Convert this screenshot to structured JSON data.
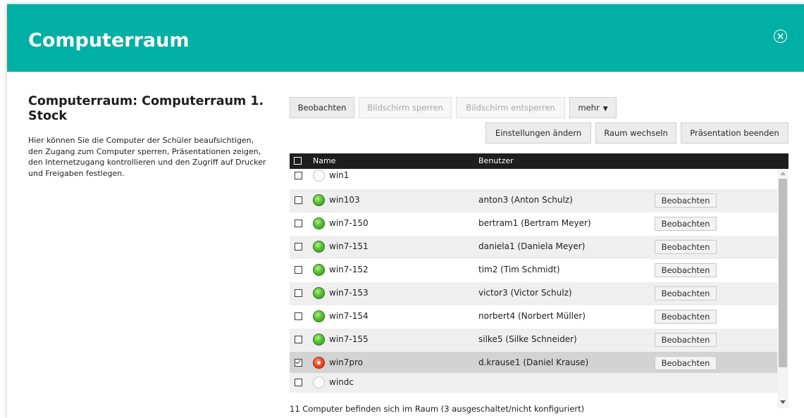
{
  "header": {
    "title": "Computerraum",
    "close_icon": "close-circle-icon",
    "color": "#00b0a4"
  },
  "sidebar": {
    "title": "Computerraum: Computerraum 1. Stock",
    "description": "Hier können Sie die Computer der Schüler beaufsichtigen, den Zugang zum Computer sperren, Präsentationen zeigen, den Internetzugang kontrollieren und den Zugriff auf Drucker und Freigaben festlegen."
  },
  "toolbar": {
    "observe": "Beobachten",
    "lock_screen": "Bildschirm sperren",
    "unlock_screen": "Bildschirm entsperren",
    "more": "mehr",
    "change_settings": "Einstellungen ändern",
    "change_room": "Raum wechseln",
    "end_presentation": "Präsentation beenden"
  },
  "grid": {
    "columns": [
      "Name",
      "Benutzer"
    ],
    "row_button_label": "Beobachten",
    "rows": [
      {
        "name": "win1",
        "user": "",
        "status": "off",
        "checked": false,
        "has_button": false
      },
      {
        "name": "win103",
        "user": "anton3 (Anton Schulz)",
        "status": "on",
        "checked": false,
        "has_button": true
      },
      {
        "name": "win7-150",
        "user": "bertram1 (Bertram Meyer)",
        "status": "on",
        "checked": false,
        "has_button": true
      },
      {
        "name": "win7-151",
        "user": "daniela1 (Daniela Meyer)",
        "status": "on",
        "checked": false,
        "has_button": true
      },
      {
        "name": "win7-152",
        "user": "tim2 (Tim Schmidt)",
        "status": "on",
        "checked": false,
        "has_button": true
      },
      {
        "name": "win7-153",
        "user": "victor3 (Victor Schulz)",
        "status": "on",
        "checked": false,
        "has_button": true
      },
      {
        "name": "win7-154",
        "user": "norbert4 (Norbert Müller)",
        "status": "on",
        "checked": false,
        "has_button": true
      },
      {
        "name": "win7-155",
        "user": "silke5 (Silke Schneider)",
        "status": "on",
        "checked": false,
        "has_button": true
      },
      {
        "name": "win7pro",
        "user": "d.krause1 (Daniel Krause)",
        "status": "err",
        "checked": true,
        "has_button": true
      },
      {
        "name": "windc",
        "user": "",
        "status": "off",
        "checked": false,
        "has_button": false
      }
    ]
  },
  "footer": {
    "summary": "11 Computer befinden sich im Raum (3 ausgeschaltet/nicht konfiguriert)"
  }
}
